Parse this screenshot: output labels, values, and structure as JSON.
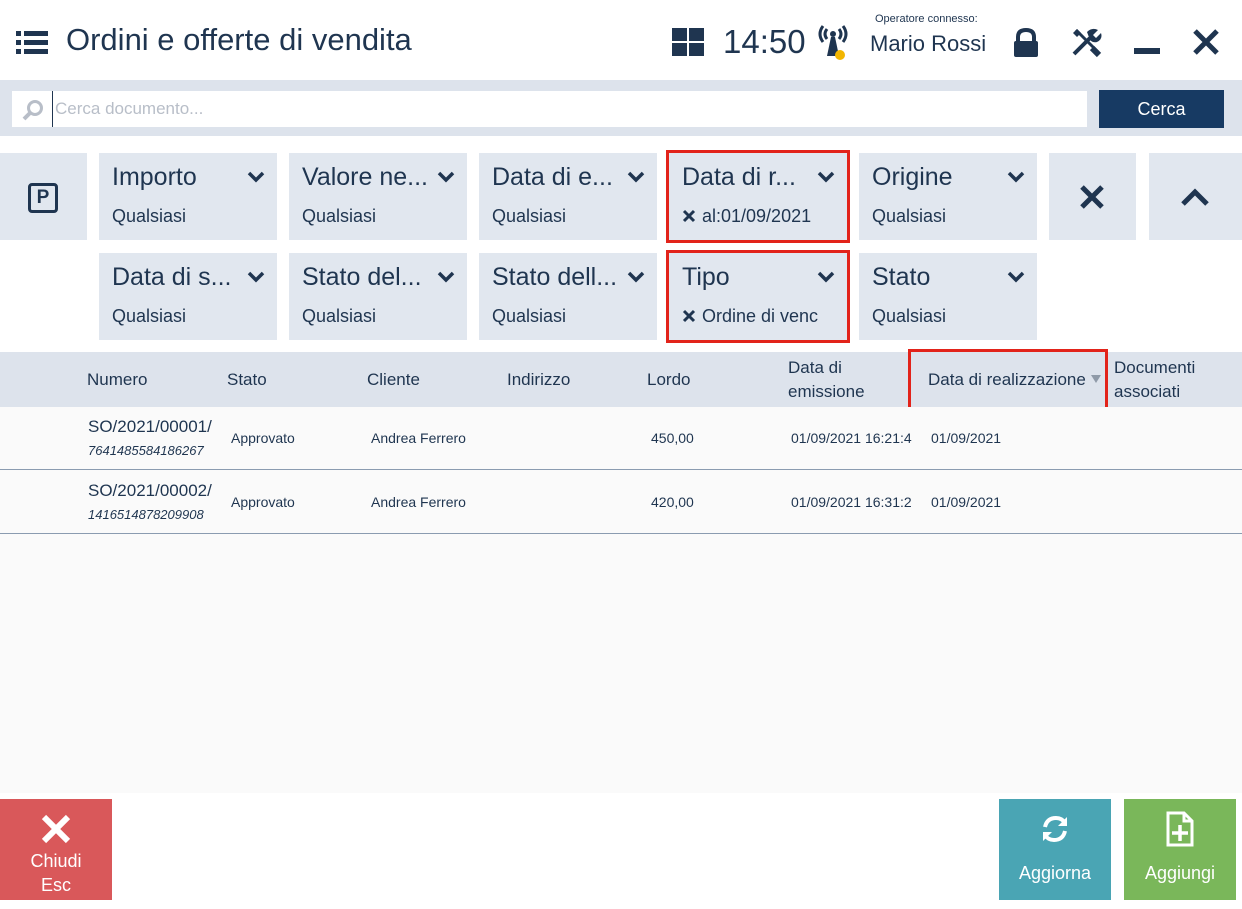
{
  "header": {
    "title": "Ordini e offerte di vendita",
    "time": "14:50",
    "operator_label": "Operatore connesso:",
    "operator_name": "Mario Rossi"
  },
  "search": {
    "placeholder": "Cerca documento...",
    "value": "",
    "button_label": "Cerca"
  },
  "filters": {
    "row1": [
      {
        "name": "Importo",
        "value": "Qualsiasi",
        "active": false
      },
      {
        "name": "Valore ne...",
        "value": "Qualsiasi",
        "active": false
      },
      {
        "name": "Data di e...",
        "value": "Qualsiasi",
        "active": false
      },
      {
        "name": "Data di r...",
        "value": "al:01/09/2021",
        "active": true
      },
      {
        "name": "Origine",
        "value": "Qualsiasi",
        "active": false
      }
    ],
    "row2": [
      {
        "name": "Data di s...",
        "value": "Qualsiasi",
        "active": false
      },
      {
        "name": "Stato del...",
        "value": "Qualsiasi",
        "active": false
      },
      {
        "name": "Stato dell...",
        "value": "Qualsiasi",
        "active": false
      },
      {
        "name": "Tipo",
        "value": "Ordine di venc",
        "active": true
      },
      {
        "name": "Stato",
        "value": "Qualsiasi",
        "active": false
      }
    ],
    "p_label": "P"
  },
  "table": {
    "columns": {
      "numero": "Numero",
      "stato": "Stato",
      "cliente": "Cliente",
      "indirizzo": "Indirizzo",
      "lordo": "Lordo",
      "data_emissione_1": "Data di",
      "data_emissione_2": "emissione",
      "data_realizzazione": "Data di realizzazione",
      "documenti_1": "Documenti",
      "documenti_2": "associati"
    },
    "rows": [
      {
        "numero": "SO/2021/00001/",
        "codice": "7641485584186267",
        "stato": "Approvato",
        "cliente": "Andrea Ferrero",
        "indirizzo": "",
        "lordo": "450,00",
        "data_emissione": "01/09/2021 16:21:4",
        "data_realizzazione": "01/09/2021",
        "documenti": ""
      },
      {
        "numero": "SO/2021/00002/",
        "codice": "1416514878209908",
        "stato": "Approvato",
        "cliente": "Andrea Ferrero",
        "indirizzo": "",
        "lordo": "420,00",
        "data_emissione": "01/09/2021 16:31:2",
        "data_realizzazione": "01/09/2021",
        "documenti": ""
      }
    ]
  },
  "footer": {
    "close_label": "Chiudi",
    "close_shortcut": "Esc",
    "refresh_label": "Aggiorna",
    "add_label": "Aggiungi"
  },
  "colors": {
    "primary": "#1f3550",
    "search_button": "#173a63",
    "highlight": "#e2231a",
    "close": "#d9585a",
    "refresh": "#4aa5b4",
    "add": "#7ab75a",
    "signal_dot": "#f2b600"
  },
  "icons": [
    "menu-icon",
    "grid-icon",
    "signal-icon",
    "lock-icon",
    "tools-icon",
    "minimize-icon",
    "close-icon",
    "search-icon",
    "parking-icon",
    "chevron-down-icon",
    "clear-filter-icon",
    "chevron-up-icon",
    "sort-desc-icon",
    "refresh-icon",
    "add-document-icon"
  ]
}
